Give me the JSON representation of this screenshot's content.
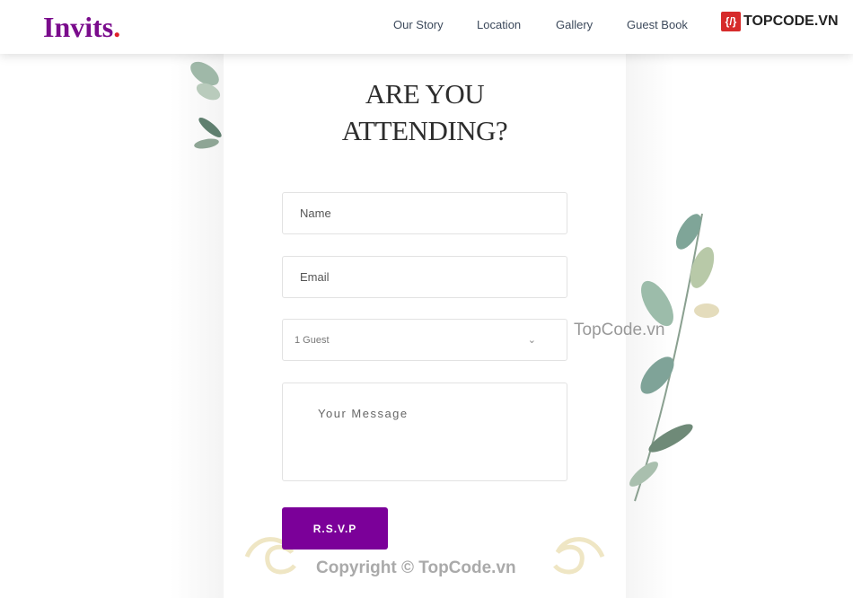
{
  "header": {
    "logo": "Invits",
    "logo_dot": ".",
    "nav": [
      "Our Story",
      "Location",
      "Gallery",
      "Guest Book"
    ],
    "watermark_logo": "TOPCODE.VN"
  },
  "rsvp": {
    "title_line1": "ARE YOU",
    "title_line2": "ATTENDING?",
    "name_placeholder": "Name",
    "email_placeholder": "Email",
    "guests_selected": "1 Guest",
    "message_placeholder": "Your Message",
    "submit_label": "R.S.V.P"
  },
  "watermarks": {
    "center": "TopCode.vn",
    "footer": "Copyright © TopCode.vn"
  },
  "colors": {
    "brand": "#7a0c8c",
    "button": "#7b0099",
    "logo_dot": "#e0202a"
  }
}
